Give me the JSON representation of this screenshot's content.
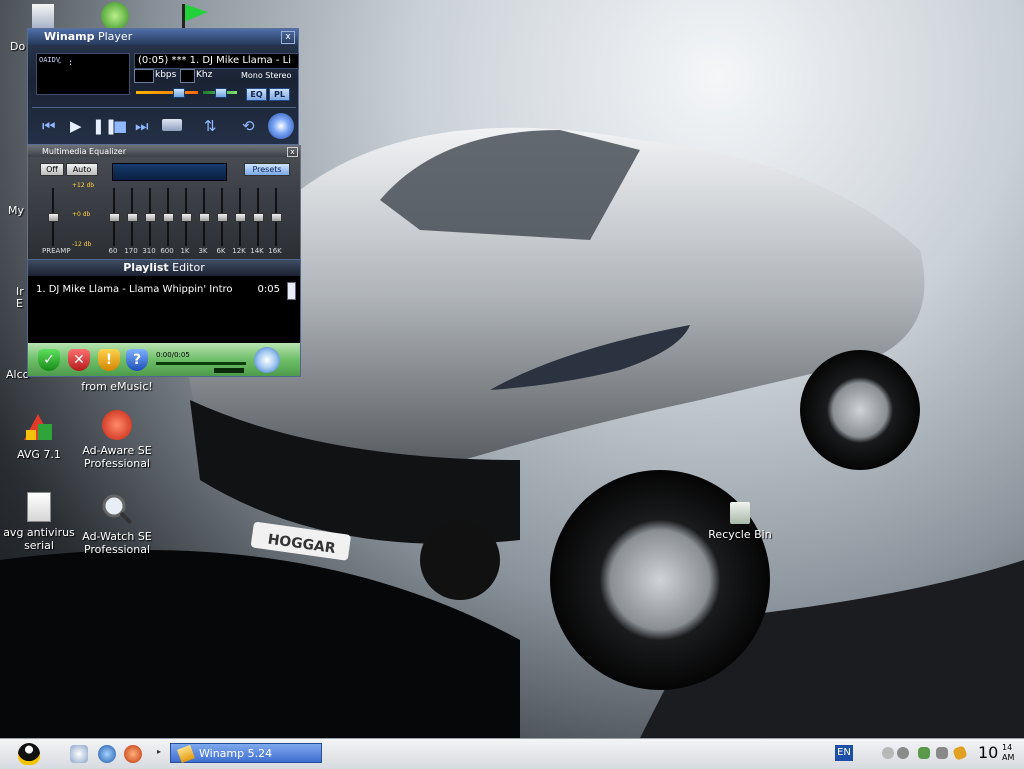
{
  "winamp": {
    "title_bold": "Winamp",
    "title_rest": " Player",
    "close": "x",
    "vis_labels": "OAIDV",
    "time_display": "- :",
    "marquee": "(0:05) *** 1. DJ Mike Llama - Li",
    "kbps_label": "kbps",
    "khz_label": "Khz",
    "mode": "Mono Stereo",
    "eq_btn": "EQ",
    "pl_btn": "PL"
  },
  "equalizer": {
    "title": "Multimedia Equalizer",
    "off": "Off",
    "auto": "Auto",
    "presets": "Presets",
    "db_top": "+12 db",
    "db_mid": "+0 db",
    "db_bot": "-12 db",
    "preamp": "PREAMP",
    "bands": [
      "60",
      "170",
      "310",
      "600",
      "1K",
      "3K",
      "6K",
      "12K",
      "14K",
      "16K"
    ]
  },
  "playlist": {
    "title_bold": "Playlist",
    "title_rest": " Editor",
    "item": "1. DJ Mike Llama - Llama Whippin' Intro",
    "duration": "0:05",
    "time": "0:00/0:05"
  },
  "desktop": {
    "icons": [
      {
        "label": "Do"
      },
      {
        "label": "My"
      },
      {
        "label": "Ir"
      },
      {
        "label": "E"
      },
      {
        "label": "Alco"
      },
      {
        "label": "from eMusic!"
      },
      {
        "label": "AVG 7.1"
      },
      {
        "label": "Ad-Aware SE Professional"
      },
      {
        "label": "avg antivirus serial"
      },
      {
        "label": "Ad-Watch SE Professional"
      },
      {
        "label": "Recycle Bin"
      }
    ],
    "plate": "HOGGAR"
  },
  "taskbar": {
    "task_label": "Winamp 5.24",
    "lang": "EN",
    "clock_h": "10",
    "clock_m": "14",
    "clock_ap": "AM"
  },
  "colors": {
    "taskbar_active": "#3f6fd0",
    "eq_bg": "#2b2e33"
  }
}
